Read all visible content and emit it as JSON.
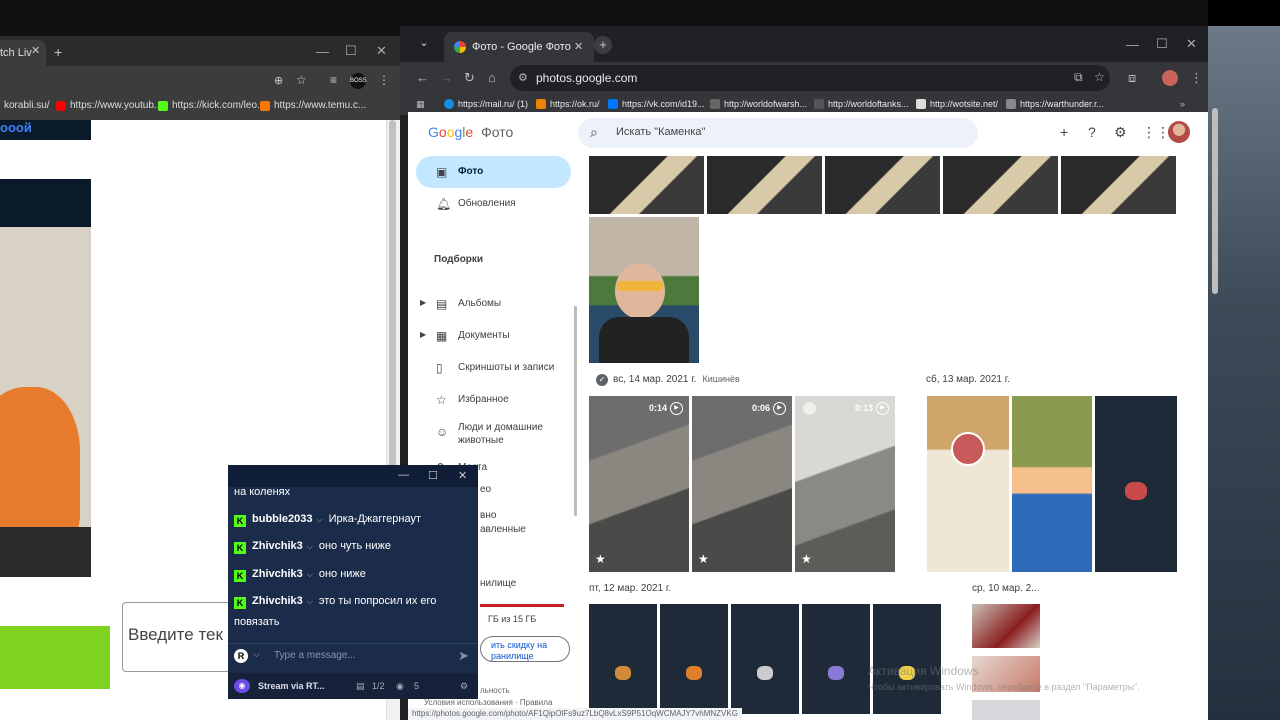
{
  "left_window": {
    "tab_title": "tch Liv",
    "bookmarks": [
      "korabli.su/",
      "https://www.youtub...",
      "https://kick.com/leo...",
      "https://www.temu.c..."
    ],
    "header_fragment": "ооой",
    "input_placeholder": "Введите тек"
  },
  "right_window": {
    "tab_title": "Фото - Google Фото",
    "url": "photos.google.com",
    "bookmarks": [
      "https://mail.ru/ (1)",
      "https://ok.ru/",
      "https://vk.com/id19...",
      "http://worldofwarsh...",
      "http://worldoftanks...",
      "http://wotsite.net/",
      "https://warthunder.r..."
    ],
    "app_name": "Фото",
    "search_placeholder": "Искать \"Каменка\"",
    "sidebar": {
      "items": [
        {
          "label": "Фото",
          "icon": "photo-icon"
        },
        {
          "label": "Обновления",
          "icon": "bell-icon"
        }
      ],
      "section_title": "Подборки",
      "collections": [
        {
          "label": "Альбомы",
          "icon": "album-icon"
        },
        {
          "label": "Документы",
          "icon": "document-icon"
        },
        {
          "label": "Скриншоты и записи",
          "icon": "phone-icon"
        },
        {
          "label": "Избранное",
          "icon": "star-icon"
        },
        {
          "label": "Люди и домашние животные",
          "icon": "face-icon"
        },
        {
          "label": "Места",
          "icon": "pin-icon"
        }
      ],
      "partial_items": [
        "ео",
        "вно",
        "авленные",
        "нилище"
      ],
      "storage_text": "ГБ из 15 ГБ",
      "storage_button": "ить скидку на ранилище",
      "footer_text": "льность",
      "footer_links": "Условия использования · Правила"
    },
    "groups": [
      {
        "date": "вс, 14 мар. 2021 г.",
        "place": "Кишинёв"
      },
      {
        "date": "сб, 13 мар. 2021 г.",
        "place": ""
      },
      {
        "date": "пт, 12 мар. 2021 г.",
        "place": ""
      },
      {
        "date": "ср, 10 мар. 2...",
        "place": ""
      }
    ],
    "video_durations": [
      "0:14",
      "0:06",
      "0:13"
    ],
    "activation_title": "Активация Windows",
    "activation_sub": "Чтобы активировать Windows, перейдите в раздел \"Параметры\".",
    "status_url": "https://photos.google.com/photo/AF1QipOlFs9uz7LbQ8vLxS9P51OqWCMAJY7vhMNZVKG"
  },
  "chat": {
    "messages": [
      {
        "user": "",
        "text": "на коленях"
      },
      {
        "user": "bubble2033",
        "text": "Ирка-Джаггернаут"
      },
      {
        "user": "Zhivchik3",
        "text": "оно чуть ниже"
      },
      {
        "user": "Zhivchik3",
        "text": "оно ниже"
      },
      {
        "user": "Zhivchik3",
        "text": "это ты попросил их его повязать"
      }
    ],
    "input_placeholder": "Type a message...",
    "stream_label": "Stream via RT...",
    "page_counter": "1/2",
    "viewers": "5"
  },
  "colors": {
    "google_blue": "#4285f4",
    "selected_nav": "#c2e7ff",
    "kick_green": "#53fc18",
    "chat_bg": "#1b2c4a"
  }
}
